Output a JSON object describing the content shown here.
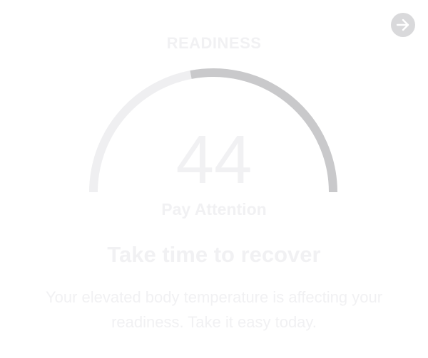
{
  "readiness": {
    "title": "READINESS",
    "score": "44",
    "score_fraction": 0.44,
    "status": "Pay Attention",
    "headline": "Take time to recover",
    "message": "Your elevated body temperature is affecting your readiness. Take it easy today."
  },
  "navigation": {
    "next_icon": "arrow-right-icon"
  },
  "colors": {
    "gauge_track": "#efeff1",
    "gauge_fill": "#c9c9cb",
    "text": "#f1f1f3",
    "button_bg": "#d9d9db",
    "button_icon": "#ffffff"
  }
}
